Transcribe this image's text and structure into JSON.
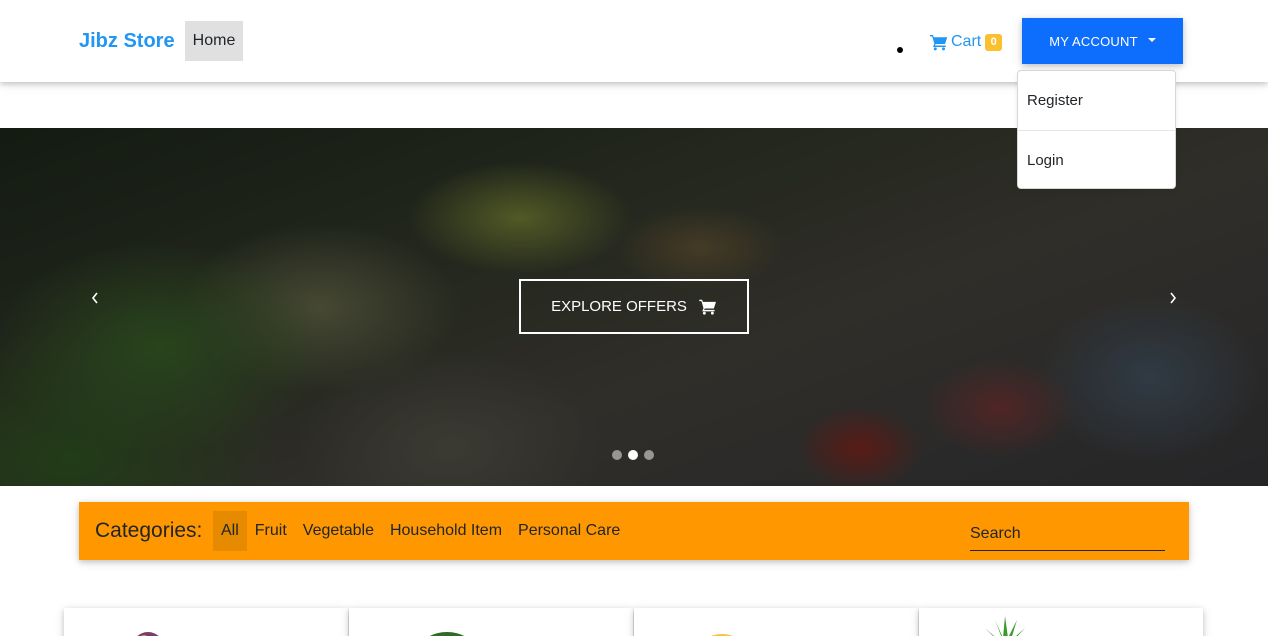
{
  "navbar": {
    "brand": "Jibz Store",
    "home_label": "Home",
    "cart_label": "Cart",
    "cart_count": "0",
    "account_label": "MY ACCOUNT",
    "account_menu": [
      "Register",
      "Login"
    ]
  },
  "hero": {
    "button_label": "EXPLORE OFFERS",
    "slide_count": 3,
    "active_slide": 2
  },
  "categories": {
    "title": "Categories:",
    "items": [
      "All",
      "Fruit",
      "Vegetable",
      "Household Item",
      "Personal Care"
    ],
    "active": "All",
    "search_placeholder": "Search"
  },
  "colors": {
    "brand": "#2196f3",
    "account_button": "#0d6efd",
    "category_bar": "#ff9800",
    "cart_badge": "#fbc02d"
  },
  "icons": [
    "shopping-cart-icon",
    "caret-down-icon",
    "chevron-left-icon",
    "chevron-right-icon"
  ]
}
